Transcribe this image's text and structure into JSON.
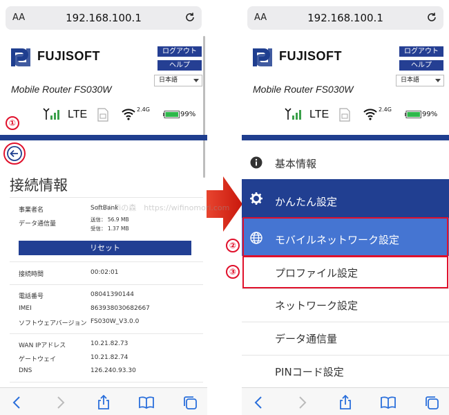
{
  "browser": {
    "aa": "AA",
    "url": "192.168.100.1"
  },
  "header": {
    "brand": "FUJISOFT",
    "logout": "ログアウト",
    "help": "ヘルプ",
    "language": "日本語",
    "model": "Mobile Router FS030W"
  },
  "status": {
    "network": "LTE",
    "wifi_band": "2.4G",
    "battery": "99%"
  },
  "annotations": {
    "n1": "①",
    "n2": "②",
    "n3": "③"
  },
  "left_page": {
    "title": "接続情報",
    "carrier_label": "事業者名",
    "carrier_value": "SoftBank",
    "data_label": "データ通信量",
    "sent": "送信： 56.9 MB",
    "received": "受信： 1.37 MB",
    "reset": "リセット",
    "conn_time_label": "接続時間",
    "conn_time_value": "00:02:01",
    "phone_label": "電話番号",
    "phone_value": "08041390144",
    "imei_label": "IMEI",
    "imei_value": "863938030682667",
    "sw_label": "ソフトウェアバージョン",
    "sw_value": "FS030W_V3.0.0",
    "wan_label": "WAN IPアドレス",
    "wan_value": "10.21.82.73",
    "gw_label": "ゲートウェイ",
    "gw_value": "10.21.82.74",
    "dns_label": "DNS",
    "dns_value": "126.240.93.30"
  },
  "watermark": "©Wi-Fiの森　https://wifinomori.com",
  "menu": {
    "basic_info": "基本情報",
    "easy_settings": "かんたん設定",
    "mobile_network": "モバイルネットワーク設定",
    "profile": "プロファイル設定",
    "network": "ネットワーク設定",
    "data_usage": "データ通信量",
    "pin": "PINコード設定"
  },
  "colors": {
    "brand_blue": "#213f91",
    "highlight_blue": "#4575d2",
    "annotation_red": "#e0102b"
  }
}
